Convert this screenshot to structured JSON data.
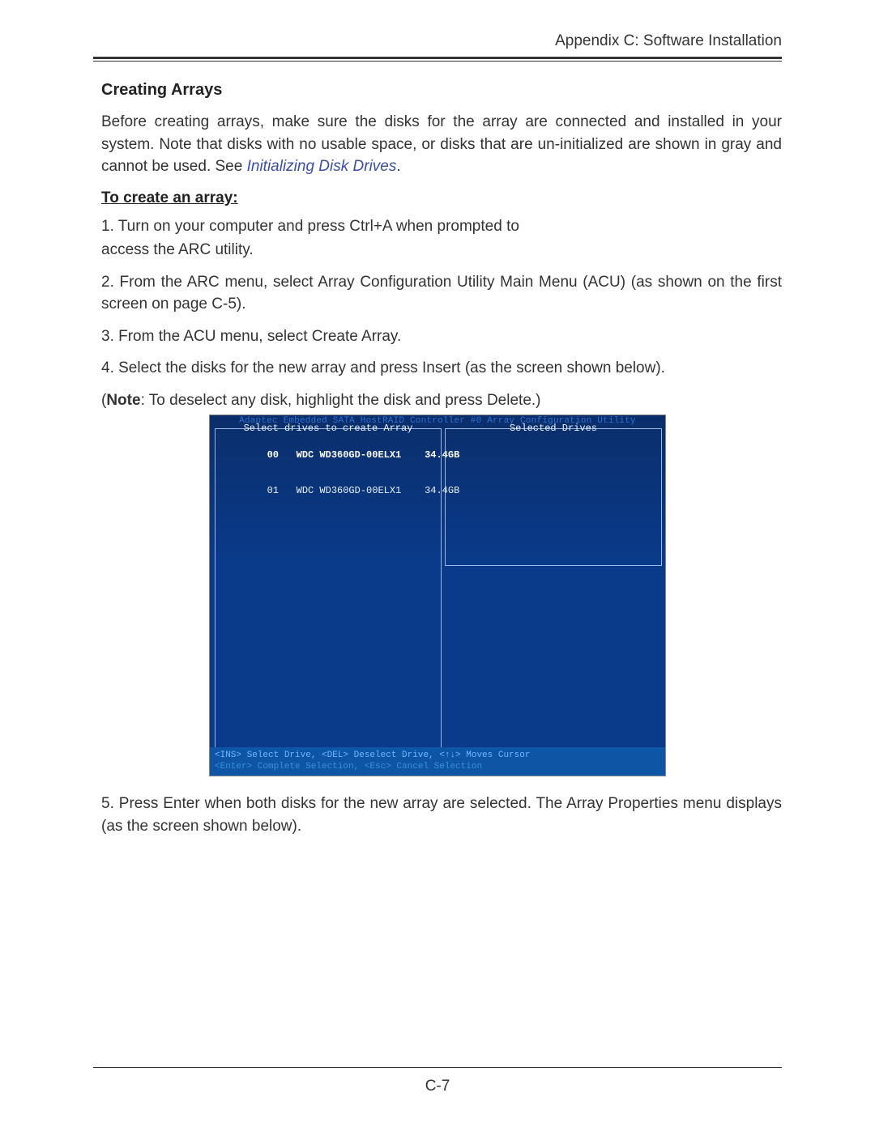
{
  "header": {
    "appendix": "Appendix C: Software Installation"
  },
  "section": {
    "title": "Creating Arrays"
  },
  "intro": {
    "text_part1": "Before creating arrays, make sure the disks for the array are connected and installed in your system. Note that disks with no usable space, or disks that are un-initialized are shown in gray and cannot be used. See ",
    "link": "Initializing Disk Drives",
    "text_part2": "."
  },
  "subhead": "To create an array:",
  "steps": {
    "s1a": "1. Turn on your computer and press Ctrl+A when prompted to",
    "s1b": "access the ARC utility.",
    "s2": "2. From the ARC menu, select Array Configuration Utility Main Menu (ACU) (as shown on the first screen on page C-5).",
    "s3": "3. From the ACU menu, select Create Array.",
    "s4": "4. Select the disks for the new array and press Insert (as the screen shown below).",
    "note_lead": "(",
    "note_bold": "Note",
    "note_tail": ": To deselect any disk, highlight the disk and press Delete.)",
    "s5": "5. Press Enter when both disks for the new array are selected. The Array Properties menu displays (as the screen shown below)."
  },
  "bios": {
    "top_title": "Adaptec Embedded SATA HostRAID Controller #0 Array Configuration Utility",
    "left_title": "Select drives to create Array",
    "right_title": "Selected Drives",
    "drives": [
      {
        "id": "00",
        "model": "WDC WD360GD-00ELX1",
        "size": "34.4GB"
      },
      {
        "id": "01",
        "model": "WDC WD360GD-00ELX1",
        "size": "34.4GB"
      }
    ],
    "footer_l1": "<INS> Select Drive, <DEL> Deselect Drive, <↑↓> Moves Cursor",
    "footer_l2": "<Enter> Complete Selection, <Esc> Cancel Selection"
  },
  "page_number": "C-7"
}
